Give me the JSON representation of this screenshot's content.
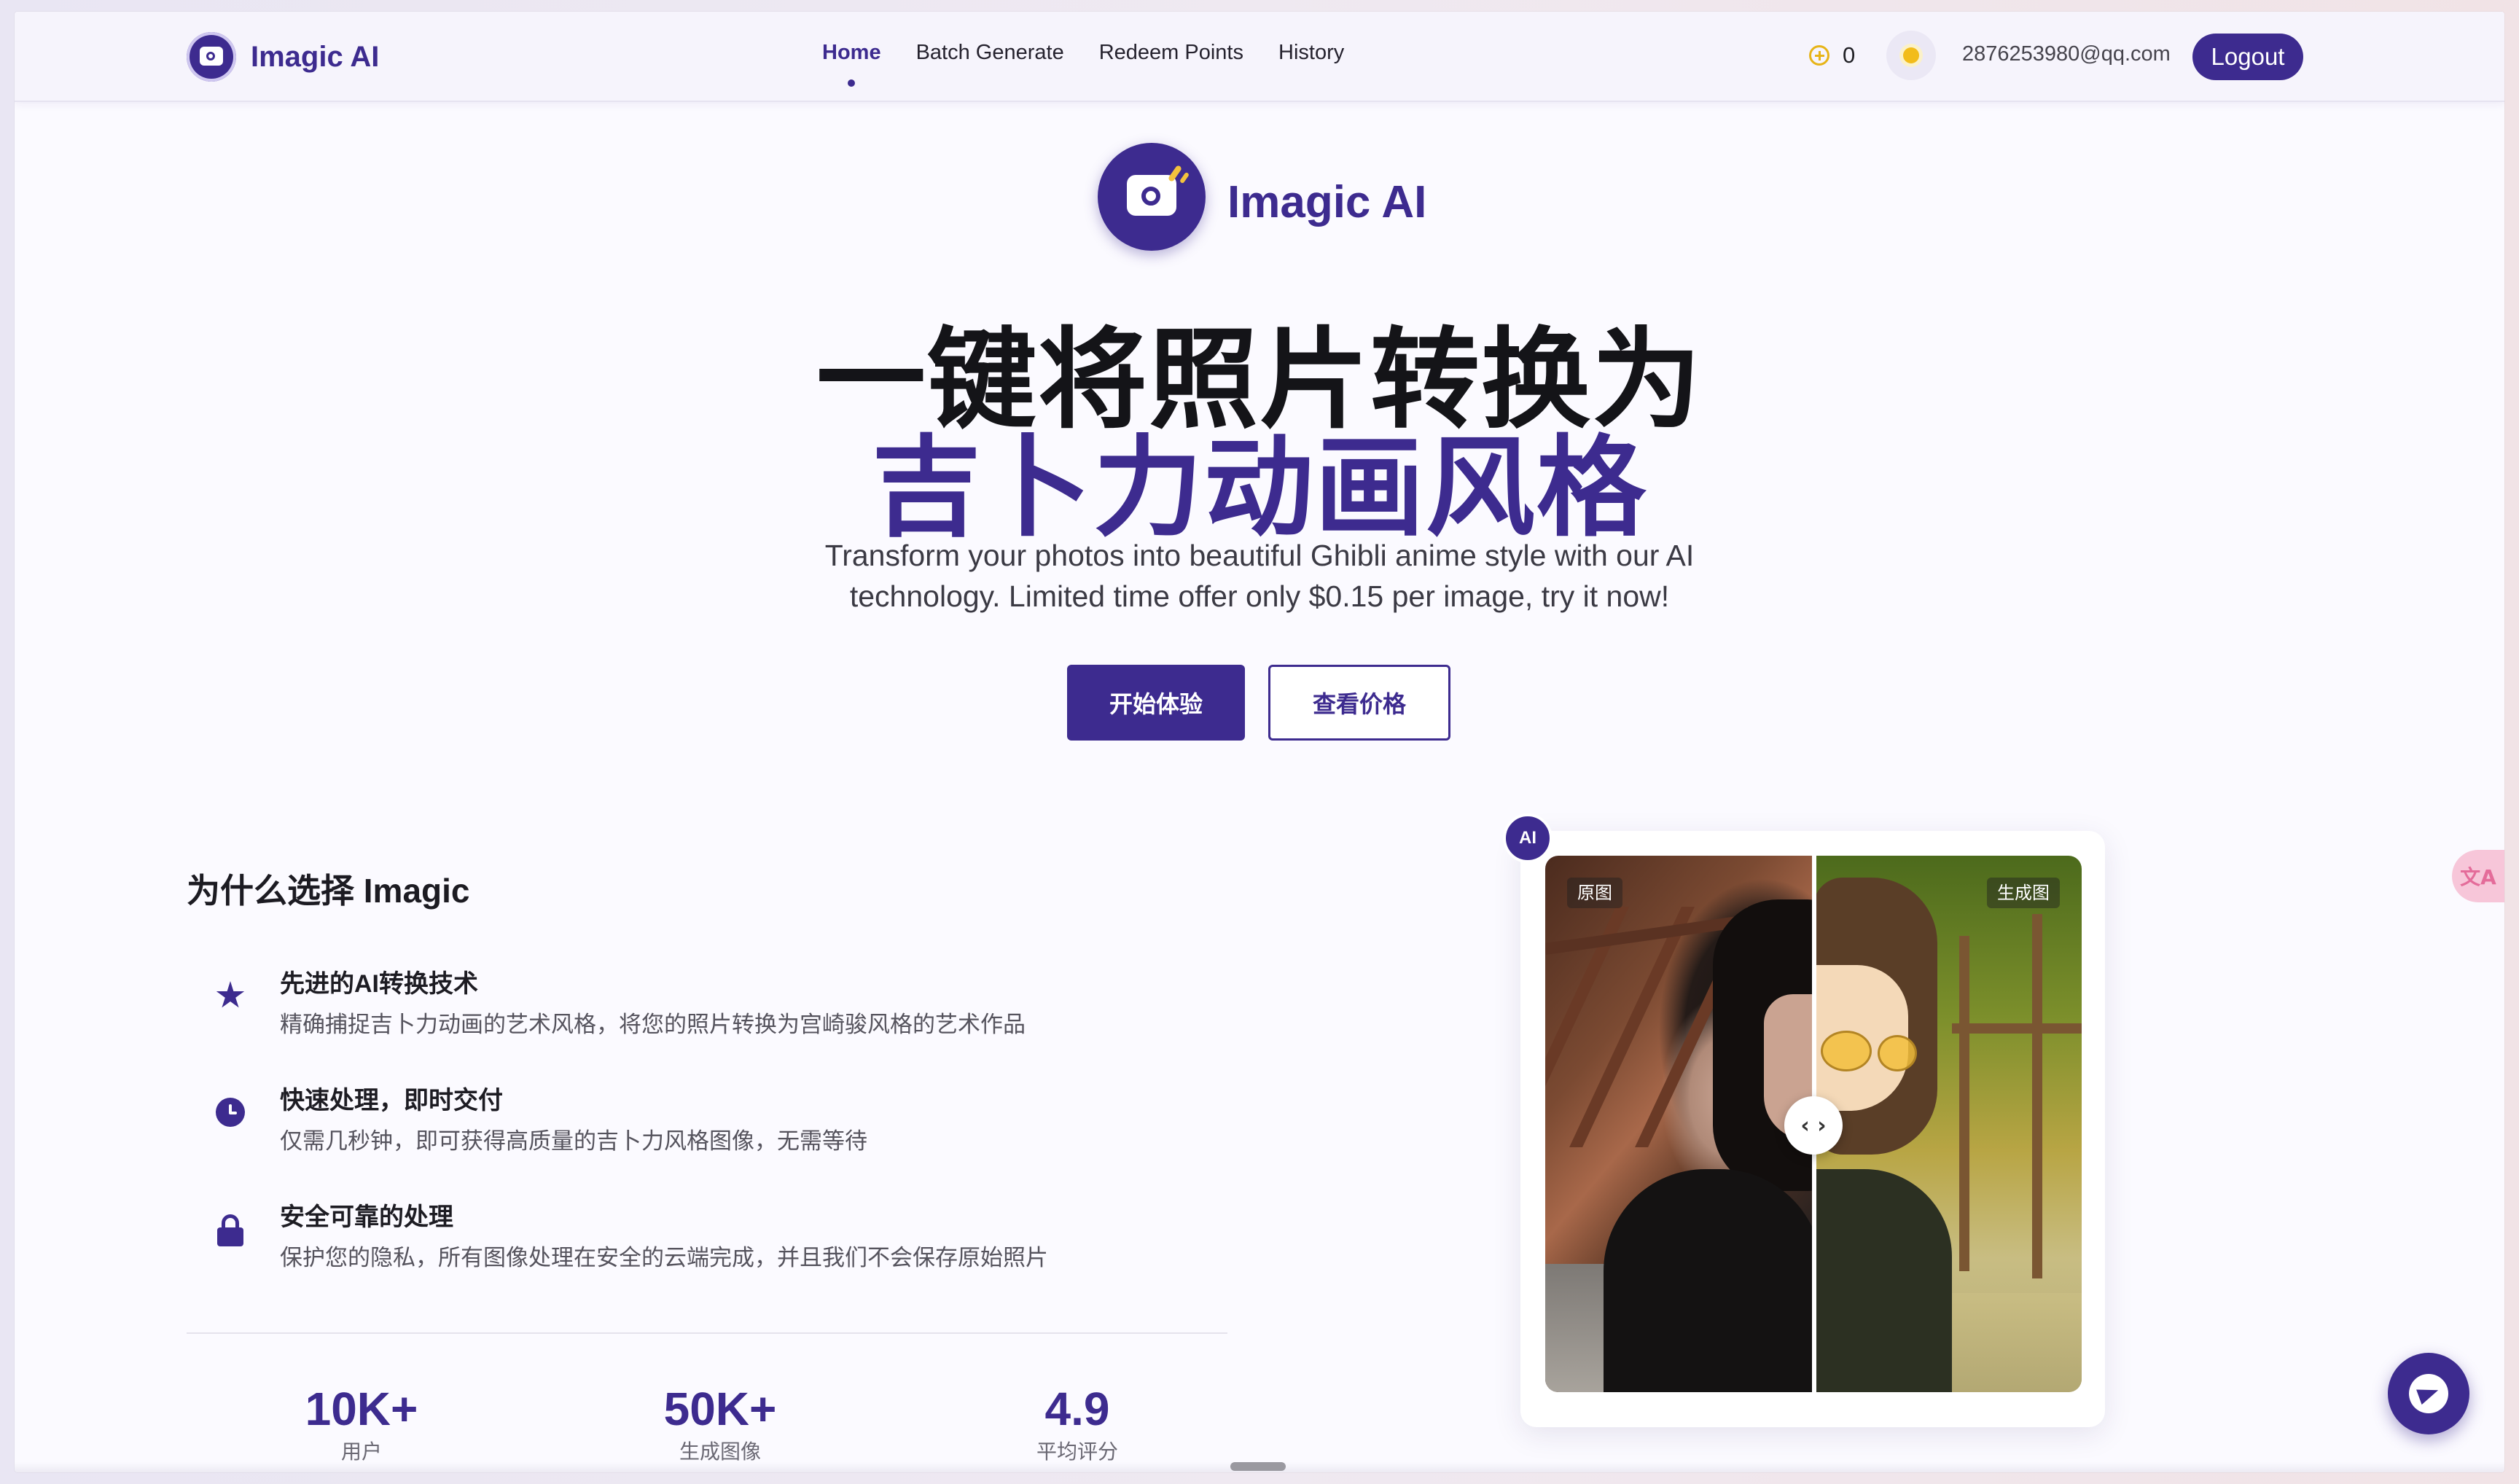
{
  "nav": {
    "brand": "Imagic AI",
    "links": [
      {
        "label": "Home",
        "active": true
      },
      {
        "label": "Batch Generate"
      },
      {
        "label": "Redeem Points"
      },
      {
        "label": "History"
      }
    ],
    "points": "0",
    "points_icon": "coin-icon",
    "theme_icon": "sun-icon",
    "email": "2876253980@qq.com",
    "logout": "Logout"
  },
  "hero": {
    "brand": "Imagic AI",
    "title_line1": "一键将照片转换为",
    "title_line2": "吉卜力动画风格",
    "subtitle": "Transform your photos into beautiful Ghibli anime style with our AI technology. Limited time offer only $0.15 per image, try it now!",
    "primary_button": "开始体验",
    "secondary_button": "查看价格"
  },
  "why": {
    "title": "为什么选择 Imagic",
    "features": [
      {
        "icon": "star-icon",
        "title": "先进的AI转换技术",
        "desc": "精确捕捉吉卜力动画的艺术风格，将您的照片转换为宫崎骏风格的艺术作品"
      },
      {
        "icon": "clock-icon",
        "title": "快速处理，即时交付",
        "desc": "仅需几秒钟，即可获得高质量的吉卜力风格图像，无需等待"
      },
      {
        "icon": "lock-icon",
        "title": "安全可靠的处理",
        "desc": "保护您的隐私，所有图像处理在安全的云端完成，并且我们不会保存原始照片"
      }
    ]
  },
  "stats": [
    {
      "value": "10K+",
      "label": "用户"
    },
    {
      "value": "50K+",
      "label": "生成图像"
    },
    {
      "value": "4.9",
      "label": "平均评分"
    }
  ],
  "compare": {
    "badge": "AI",
    "original_label": "原图",
    "generated_label": "生成图",
    "handle": "‹ ›"
  },
  "widgets": {
    "translate": "文A",
    "chat_icon": "telegram-icon"
  },
  "colors": {
    "brand": "#3d2b8f",
    "coin": "#e7b418"
  }
}
